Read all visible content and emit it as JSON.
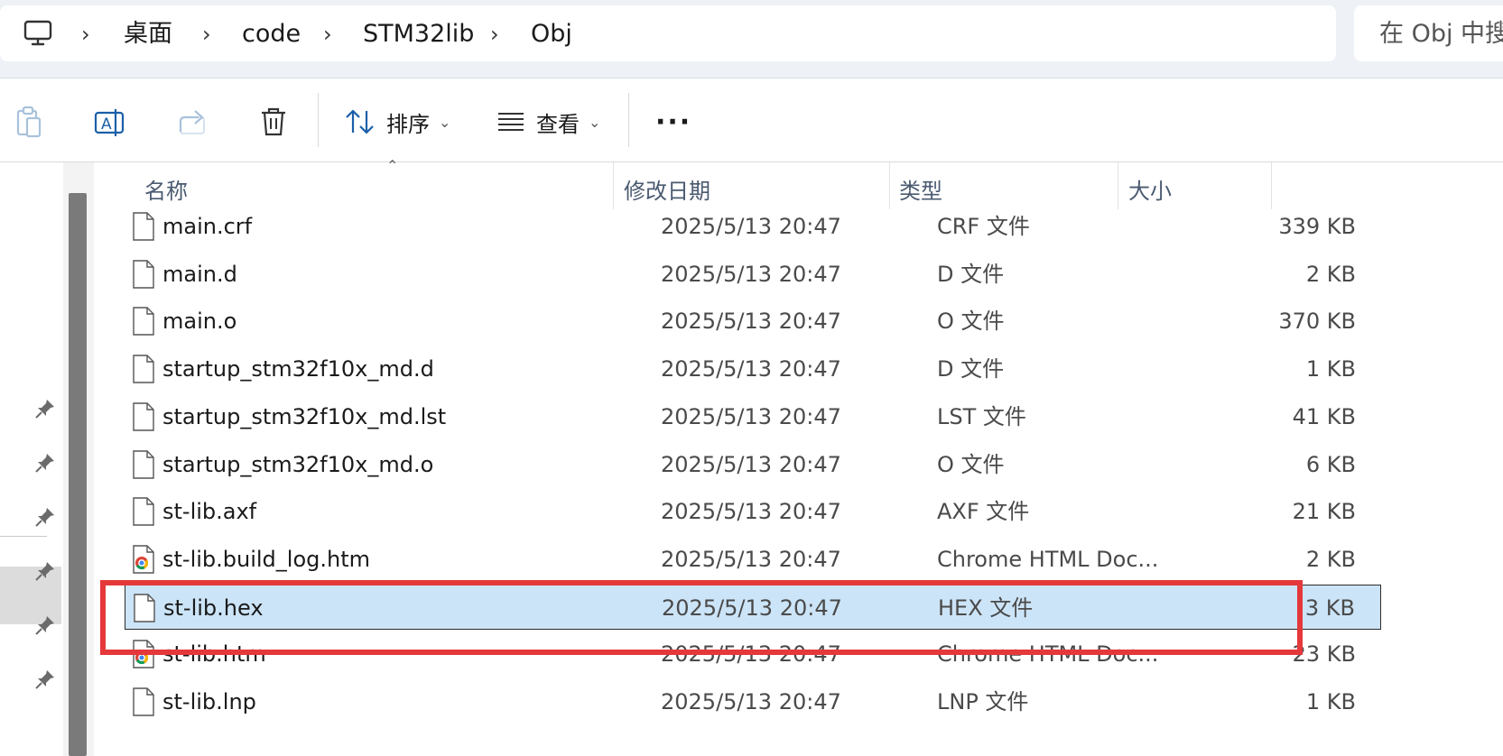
{
  "address_bar": {
    "crumbs": [
      "桌面",
      "code",
      "STM32lib",
      "Obj"
    ],
    "search_placeholder": "在 Obj 中搜"
  },
  "toolbar": {
    "sort_label": "排序",
    "view_label": "查看",
    "more_label": "···"
  },
  "columns": {
    "name": "名称",
    "date": "修改日期",
    "type": "类型",
    "size": "大小"
  },
  "files": [
    {
      "name": "main.crf",
      "date": "2025/5/13 20:47",
      "type": "CRF 文件",
      "size": "339 KB",
      "icon": "file-icon"
    },
    {
      "name": "main.d",
      "date": "2025/5/13 20:47",
      "type": "D 文件",
      "size": "2 KB",
      "icon": "file-icon"
    },
    {
      "name": "main.o",
      "date": "2025/5/13 20:47",
      "type": "O 文件",
      "size": "370 KB",
      "icon": "file-icon"
    },
    {
      "name": "startup_stm32f10x_md.d",
      "date": "2025/5/13 20:47",
      "type": "D 文件",
      "size": "1 KB",
      "icon": "file-icon"
    },
    {
      "name": "startup_stm32f10x_md.lst",
      "date": "2025/5/13 20:47",
      "type": "LST 文件",
      "size": "41 KB",
      "icon": "file-icon"
    },
    {
      "name": "startup_stm32f10x_md.o",
      "date": "2025/5/13 20:47",
      "type": "O 文件",
      "size": "6 KB",
      "icon": "file-icon"
    },
    {
      "name": "st-lib.axf",
      "date": "2025/5/13 20:47",
      "type": "AXF 文件",
      "size": "21 KB",
      "icon": "file-icon"
    },
    {
      "name": "st-lib.build_log.htm",
      "date": "2025/5/13 20:47",
      "type": "Chrome HTML Doc...",
      "size": "2 KB",
      "icon": "chrome-icon"
    },
    {
      "name": "st-lib.hex",
      "date": "2025/5/13 20:47",
      "type": "HEX 文件",
      "size": "3 KB",
      "icon": "file-icon",
      "selected": true
    },
    {
      "name": "st-lib.htm",
      "date": "2025/5/13 20:47",
      "type": "Chrome HTML Doc...",
      "size": "23 KB",
      "icon": "chrome-icon"
    },
    {
      "name": "st-lib.lnp",
      "date": "2025/5/13 20:47",
      "type": "LNP 文件",
      "size": "1 KB",
      "icon": "file-icon"
    }
  ],
  "colors": {
    "selection": "#cce4f7",
    "highlight_annotation": "#e5383b"
  }
}
